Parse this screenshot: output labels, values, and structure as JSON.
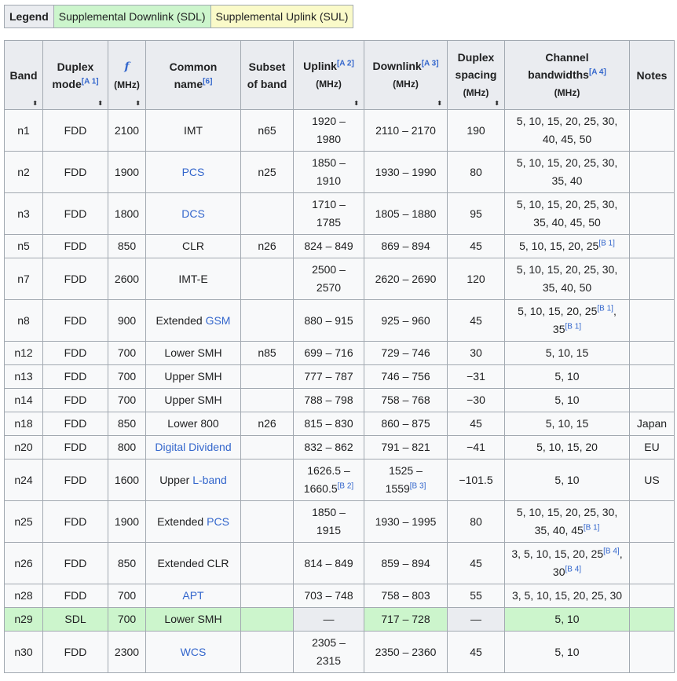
{
  "legend": {
    "title": "Legend",
    "sdl": "Supplemental Downlink (SDL)",
    "sul": "Supplemental Uplink (SUL)"
  },
  "columns": {
    "band": "Band",
    "duplex_line1": "Duplex",
    "duplex_line2": "mode",
    "duplex_ref": "[A 1]",
    "freq": "f",
    "freq_unit": "(MHz)",
    "common_line1": "Common",
    "common_line2": "name",
    "common_ref": "[6]",
    "subset_line1": "Subset",
    "subset_line2": "of band",
    "uplink": "Uplink",
    "uplink_ref": "[A 2]",
    "uplink_unit": "(MHz)",
    "downlink": "Downlink",
    "downlink_ref": "[A 3]",
    "downlink_unit": "(MHz)",
    "spacing_line1": "Duplex",
    "spacing_line2": "spacing",
    "spacing_unit": "(MHz)",
    "bw_line1": "Channel",
    "bw_line2": "bandwidths",
    "bw_ref": "[A 4]",
    "bw_unit": "(MHz)",
    "notes": "Notes",
    "sort_icon": "⬍"
  },
  "rows": [
    {
      "band": "n1",
      "mode": "FDD",
      "freq": "2100",
      "name_pre": "IMT",
      "name_link": "",
      "subset": "n65",
      "up": "1920 –",
      "up2": "1980",
      "up_ref": "",
      "down": "2110 – 2170",
      "down2": "",
      "down_ref": "",
      "spacing": "190",
      "bw": "5, 10, 15, 20, 25, 30,",
      "bw2": "40, 45, 50",
      "bw_ref": "",
      "bw_mid": "",
      "bw_ref2": "",
      "notes": ""
    },
    {
      "band": "n2",
      "mode": "FDD",
      "freq": "1900",
      "name_pre": "",
      "name_link": "PCS",
      "subset": "n25",
      "up": "1850 –",
      "up2": "1910",
      "up_ref": "",
      "down": "1930 – 1990",
      "down2": "",
      "down_ref": "",
      "spacing": "80",
      "bw": "5, 10, 15, 20, 25, 30,",
      "bw2": "35, 40",
      "bw_ref": "",
      "bw_mid": "",
      "bw_ref2": "",
      "notes": ""
    },
    {
      "band": "n3",
      "mode": "FDD",
      "freq": "1800",
      "name_pre": "",
      "name_link": "DCS",
      "subset": "",
      "up": "1710 –",
      "up2": "1785",
      "up_ref": "",
      "down": "1805 – 1880",
      "down2": "",
      "down_ref": "",
      "spacing": "95",
      "bw": "5, 10, 15, 20, 25, 30,",
      "bw2": "35, 40, 45, 50",
      "bw_ref": "",
      "bw_mid": "",
      "bw_ref2": "",
      "notes": ""
    },
    {
      "band": "n5",
      "mode": "FDD",
      "freq": "850",
      "name_pre": "CLR",
      "name_link": "",
      "subset": "n26",
      "up": "824 – 849",
      "up2": "",
      "up_ref": "",
      "down": "869 – 894",
      "down2": "",
      "down_ref": "",
      "spacing": "45",
      "bw": "5, 10, 15, 20, 25",
      "bw2": "",
      "bw_ref": "[B 1]",
      "bw_mid": "",
      "bw_ref2": "",
      "notes": ""
    },
    {
      "band": "n7",
      "mode": "FDD",
      "freq": "2600",
      "name_pre": "IMT-E",
      "name_link": "",
      "subset": "",
      "up": "2500 –",
      "up2": "2570",
      "up_ref": "",
      "down": "2620 – 2690",
      "down2": "",
      "down_ref": "",
      "spacing": "120",
      "bw": "5, 10, 15, 20, 25, 30,",
      "bw2": "35, 40, 50",
      "bw_ref": "",
      "bw_mid": "",
      "bw_ref2": "",
      "notes": ""
    },
    {
      "band": "n8",
      "mode": "FDD",
      "freq": "900",
      "name_pre": "Extended ",
      "name_link": "GSM",
      "subset": "",
      "up": "880 – 915",
      "up2": "",
      "up_ref": "",
      "down": "925 – 960",
      "down2": "",
      "down_ref": "",
      "spacing": "45",
      "bw": "5, 10, 15, 20, 25",
      "bw2": "35",
      "bw_ref": "[B 1]",
      "bw_mid": ",",
      "bw_ref2": "[B 1]",
      "notes": ""
    },
    {
      "band": "n12",
      "mode": "FDD",
      "freq": "700",
      "name_pre": "Lower SMH",
      "name_link": "",
      "subset": "n85",
      "up": "699 – 716",
      "up2": "",
      "up_ref": "",
      "down": "729 – 746",
      "down2": "",
      "down_ref": "",
      "spacing": "30",
      "bw": "5, 10, 15",
      "bw2": "",
      "bw_ref": "",
      "bw_mid": "",
      "bw_ref2": "",
      "notes": ""
    },
    {
      "band": "n13",
      "mode": "FDD",
      "freq": "700",
      "name_pre": "Upper SMH",
      "name_link": "",
      "subset": "",
      "up": "777 – 787",
      "up2": "",
      "up_ref": "",
      "down": "746 – 756",
      "down2": "",
      "down_ref": "",
      "spacing": "−31",
      "bw": "5, 10",
      "bw2": "",
      "bw_ref": "",
      "bw_mid": "",
      "bw_ref2": "",
      "notes": ""
    },
    {
      "band": "n14",
      "mode": "FDD",
      "freq": "700",
      "name_pre": "Upper SMH",
      "name_link": "",
      "subset": "",
      "up": "788 – 798",
      "up2": "",
      "up_ref": "",
      "down": "758 – 768",
      "down2": "",
      "down_ref": "",
      "spacing": "−30",
      "bw": "5, 10",
      "bw2": "",
      "bw_ref": "",
      "bw_mid": "",
      "bw_ref2": "",
      "notes": ""
    },
    {
      "band": "n18",
      "mode": "FDD",
      "freq": "850",
      "name_pre": "Lower 800",
      "name_link": "",
      "subset": "n26",
      "up": "815 – 830",
      "up2": "",
      "up_ref": "",
      "down": "860 – 875",
      "down2": "",
      "down_ref": "",
      "spacing": "45",
      "bw": "5, 10, 15",
      "bw2": "",
      "bw_ref": "",
      "bw_mid": "",
      "bw_ref2": "",
      "notes": "Japan"
    },
    {
      "band": "n20",
      "mode": "FDD",
      "freq": "800",
      "name_pre": "",
      "name_link": "Digital Dividend",
      "subset": "",
      "up": "832 – 862",
      "up2": "",
      "up_ref": "",
      "down": "791 – 821",
      "down2": "",
      "down_ref": "",
      "spacing": "−41",
      "bw": "5, 10, 15, 20",
      "bw2": "",
      "bw_ref": "",
      "bw_mid": "",
      "bw_ref2": "",
      "notes": "EU"
    },
    {
      "band": "n24",
      "mode": "FDD",
      "freq": "1600",
      "name_pre": "Upper ",
      "name_link": "L-band",
      "subset": "",
      "up": "1626.5 –",
      "up2": "1660.5",
      "up_ref": "[B 2]",
      "down": "1525 –",
      "down2": "1559",
      "down_ref": "[B 3]",
      "spacing": "−101.5",
      "bw": "5, 10",
      "bw2": "",
      "bw_ref": "",
      "bw_mid": "",
      "bw_ref2": "",
      "notes": "US"
    },
    {
      "band": "n25",
      "mode": "FDD",
      "freq": "1900",
      "name_pre": "Extended ",
      "name_link": "PCS",
      "subset": "",
      "up": "1850 –",
      "up2": "1915",
      "up_ref": "",
      "down": "1930 – 1995",
      "down2": "",
      "down_ref": "",
      "spacing": "80",
      "bw": "5, 10, 15, 20, 25, 30,",
      "bw2": "35, 40, 45",
      "bw_ref": "",
      "bw_mid": "",
      "bw_ref2": "[B 1]",
      "notes": ""
    },
    {
      "band": "n26",
      "mode": "FDD",
      "freq": "850",
      "name_pre": "Extended CLR",
      "name_link": "",
      "subset": "",
      "up": "814 – 849",
      "up2": "",
      "up_ref": "",
      "down": "859 – 894",
      "down2": "",
      "down_ref": "",
      "spacing": "45",
      "bw": "3, 5, 10, 15, 20, 25",
      "bw2": "30",
      "bw_ref": "[B 4]",
      "bw_mid": ",",
      "bw_ref2": "[B 4]",
      "notes": ""
    },
    {
      "band": "n28",
      "mode": "FDD",
      "freq": "700",
      "name_pre": "",
      "name_link": "APT",
      "subset": "",
      "up": "703 – 748",
      "up2": "",
      "up_ref": "",
      "down": "758 – 803",
      "down2": "",
      "down_ref": "",
      "spacing": "55",
      "bw": "3, 5, 10, 15, 20, 25, 30",
      "bw2": "",
      "bw_ref": "",
      "bw_mid": "",
      "bw_ref2": "",
      "notes": ""
    },
    {
      "band": "n29",
      "mode": "SDL",
      "freq": "700",
      "name_pre": "Lower SMH",
      "name_link": "",
      "subset": "",
      "up": "—",
      "up2": "",
      "up_ref": "",
      "down": "717 – 728",
      "down2": "",
      "down_ref": "",
      "spacing": "—",
      "bw": "5, 10",
      "bw2": "",
      "bw_ref": "",
      "bw_mid": "",
      "bw_ref2": "",
      "notes": ""
    },
    {
      "band": "n30",
      "mode": "FDD",
      "freq": "2300",
      "name_pre": "",
      "name_link": "WCS",
      "subset": "",
      "up": "2305 –",
      "up2": "2315",
      "up_ref": "",
      "down": "2350 – 2360",
      "down2": "",
      "down_ref": "",
      "spacing": "45",
      "bw": "5, 10",
      "bw2": "",
      "bw_ref": "",
      "bw_mid": "",
      "bw_ref2": "",
      "notes": ""
    }
  ]
}
